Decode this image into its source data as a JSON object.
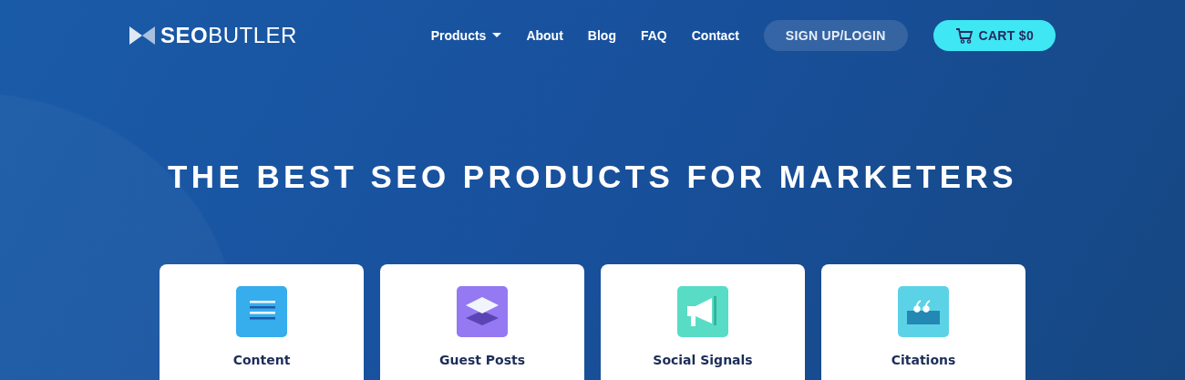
{
  "header": {
    "logo": "**SEO**BUTLER",
    "nav": [
      {
        "label": "Products",
        "dropdown": true
      },
      {
        "label": "About",
        "dropdown": false
      },
      {
        "label": "Blog",
        "dropdown": false
      },
      {
        "label": "FAQ",
        "dropdown": false
      },
      {
        "label": "Contact",
        "dropdown": false
      }
    ],
    "signup": "SIGN UP/LOGIN",
    "cart": "CART $0"
  },
  "hero": {
    "title": "THE BEST SEO PRODUCTS FOR MARKETERS"
  },
  "products": [
    {
      "label": "Content",
      "kind": "lines",
      "color": "#36aded"
    },
    {
      "label": "Guest Posts",
      "kind": "layers",
      "color": "#9479f2"
    },
    {
      "label": "Social Signals",
      "kind": "megaphone",
      "color": "#58dcc6"
    },
    {
      "label": "Citations",
      "kind": "quote",
      "color": "#5cd2e6"
    }
  ]
}
